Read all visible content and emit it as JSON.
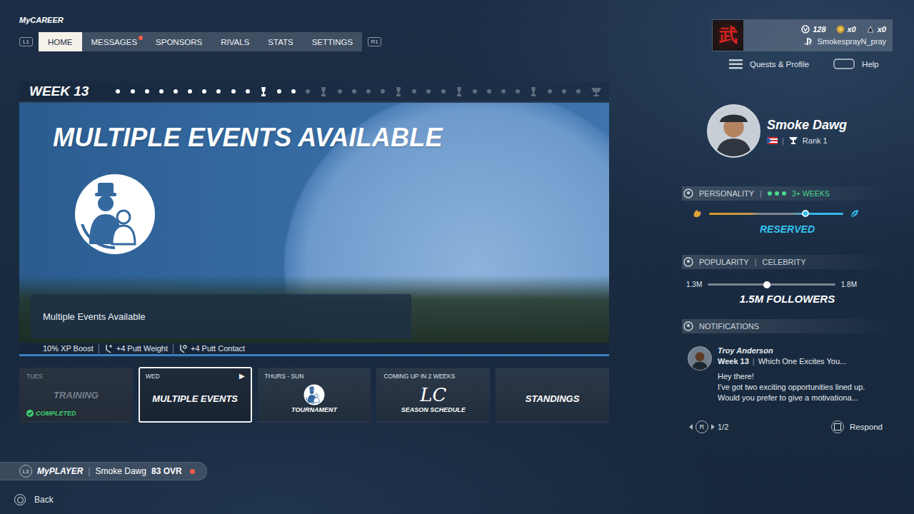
{
  "app": {
    "title": "MyCAREER"
  },
  "separator": "|",
  "nav": {
    "left_button": "L1",
    "right_button": "R1",
    "tabs": [
      {
        "label": "HOME",
        "selected": true,
        "badge": false
      },
      {
        "label": "MESSAGES",
        "selected": false,
        "badge": true
      },
      {
        "label": "SPONSORS",
        "selected": false,
        "badge": false
      },
      {
        "label": "RIVALS",
        "selected": false,
        "badge": false
      },
      {
        "label": "STATS",
        "selected": false,
        "badge": false
      },
      {
        "label": "SETTINGS",
        "selected": false,
        "badge": false
      }
    ]
  },
  "account": {
    "logo": "武",
    "currencies": [
      {
        "kind": "vc",
        "value": "128"
      },
      {
        "kind": "coin",
        "value": "x0"
      },
      {
        "kind": "token",
        "value": "x0"
      }
    ],
    "username": "SmokesprayN_pray"
  },
  "menu": [
    {
      "kind": "menu",
      "label": "Quests & Profile"
    },
    {
      "kind": "touchpad",
      "label": "Help"
    }
  ],
  "week": {
    "title": "WEEK 13",
    "timeline": [
      {
        "kind": "dot",
        "done": true
      },
      {
        "kind": "dot",
        "done": true
      },
      {
        "kind": "dot",
        "done": true
      },
      {
        "kind": "dot",
        "done": true
      },
      {
        "kind": "dot",
        "done": true
      },
      {
        "kind": "dot",
        "done": true
      },
      {
        "kind": "dot",
        "done": true
      },
      {
        "kind": "dot",
        "done": true
      },
      {
        "kind": "dot",
        "done": true
      },
      {
        "kind": "dot",
        "done": true
      },
      {
        "kind": "trophy",
        "done": true
      },
      {
        "kind": "dot",
        "done": true
      },
      {
        "kind": "dot",
        "done": true
      },
      {
        "kind": "dot",
        "done": false
      },
      {
        "kind": "trophy",
        "done": false
      },
      {
        "kind": "dot",
        "done": false
      },
      {
        "kind": "dot",
        "done": false
      },
      {
        "kind": "dot",
        "done": false
      },
      {
        "kind": "dot",
        "done": false
      },
      {
        "kind": "trophy",
        "done": false
      },
      {
        "kind": "dot",
        "done": false
      },
      {
        "kind": "dot",
        "done": false
      },
      {
        "kind": "dot",
        "done": false
      },
      {
        "kind": "trophy",
        "done": false
      },
      {
        "kind": "dot",
        "done": false
      },
      {
        "kind": "dot",
        "done": false
      },
      {
        "kind": "dot",
        "done": false
      },
      {
        "kind": "dot",
        "done": false
      },
      {
        "kind": "trophy",
        "done": false
      },
      {
        "kind": "dot",
        "done": false
      },
      {
        "kind": "dot",
        "done": false
      },
      {
        "kind": "dot",
        "done": false
      },
      {
        "kind": "cup",
        "done": false
      }
    ]
  },
  "feature": {
    "title": "MULTIPLE EVENTS AVAILABLE",
    "caption": "Multiple Events Available",
    "perks": [
      {
        "kind": "text",
        "label": "10% XP Boost"
      },
      {
        "kind": "weight",
        "label": "+4 Putt Weight"
      },
      {
        "kind": "contact",
        "label": "+4 Putt Contact"
      }
    ]
  },
  "schedule": [
    {
      "kind": "plain",
      "day": "TUES",
      "label": "TRAINING",
      "status": "COMPLETED",
      "completed": true,
      "selected": false
    },
    {
      "kind": "plain",
      "day": "WED",
      "label": "MULTIPLE EVENTS",
      "play_icon": "▶",
      "completed": false,
      "selected": true
    },
    {
      "kind": "icon",
      "day": "THURS - SUN",
      "label": "TOURNAMENT",
      "completed": false,
      "selected": false
    },
    {
      "kind": "logo",
      "day": "COMING UP IN 2 WEEKS",
      "logo": "LC",
      "label": "SEASON SCHEDULE",
      "completed": false,
      "selected": false
    },
    {
      "kind": "plain",
      "label": "STANDINGS",
      "completed": false,
      "selected": false
    }
  ],
  "player": {
    "name": "Smoke Dawg",
    "rank": "Rank 1"
  },
  "personality": {
    "title": "PERSONALITY",
    "streak_dots": 3,
    "streak": "3+ WEEKS",
    "level": 0.72,
    "value": "RESERVED"
  },
  "popularity": {
    "title": "POPULARITY",
    "tier": "CELEBRITY",
    "min": "1.3M",
    "max": "1.8M",
    "level": 0.465,
    "followers": "1.5M FOLLOWERS"
  },
  "notifications": {
    "title": "NOTIFICATIONS",
    "items": [
      {
        "sender": "Troy Anderson",
        "week": "Week 13",
        "subject": "Which One Excites You...",
        "lines": [
          "Hey there!",
          "I've got two exciting opportunities lined up.",
          "Would you prefer to give a motivationa..."
        ]
      }
    ],
    "pager_button": "R",
    "page": "1/2",
    "action": "Respond"
  },
  "myplayer": {
    "button": "L3",
    "label": "MyPLAYER",
    "name": "Smoke Dawg",
    "rating": "83 OVR",
    "alert": true
  },
  "back": {
    "label": "Back"
  }
}
